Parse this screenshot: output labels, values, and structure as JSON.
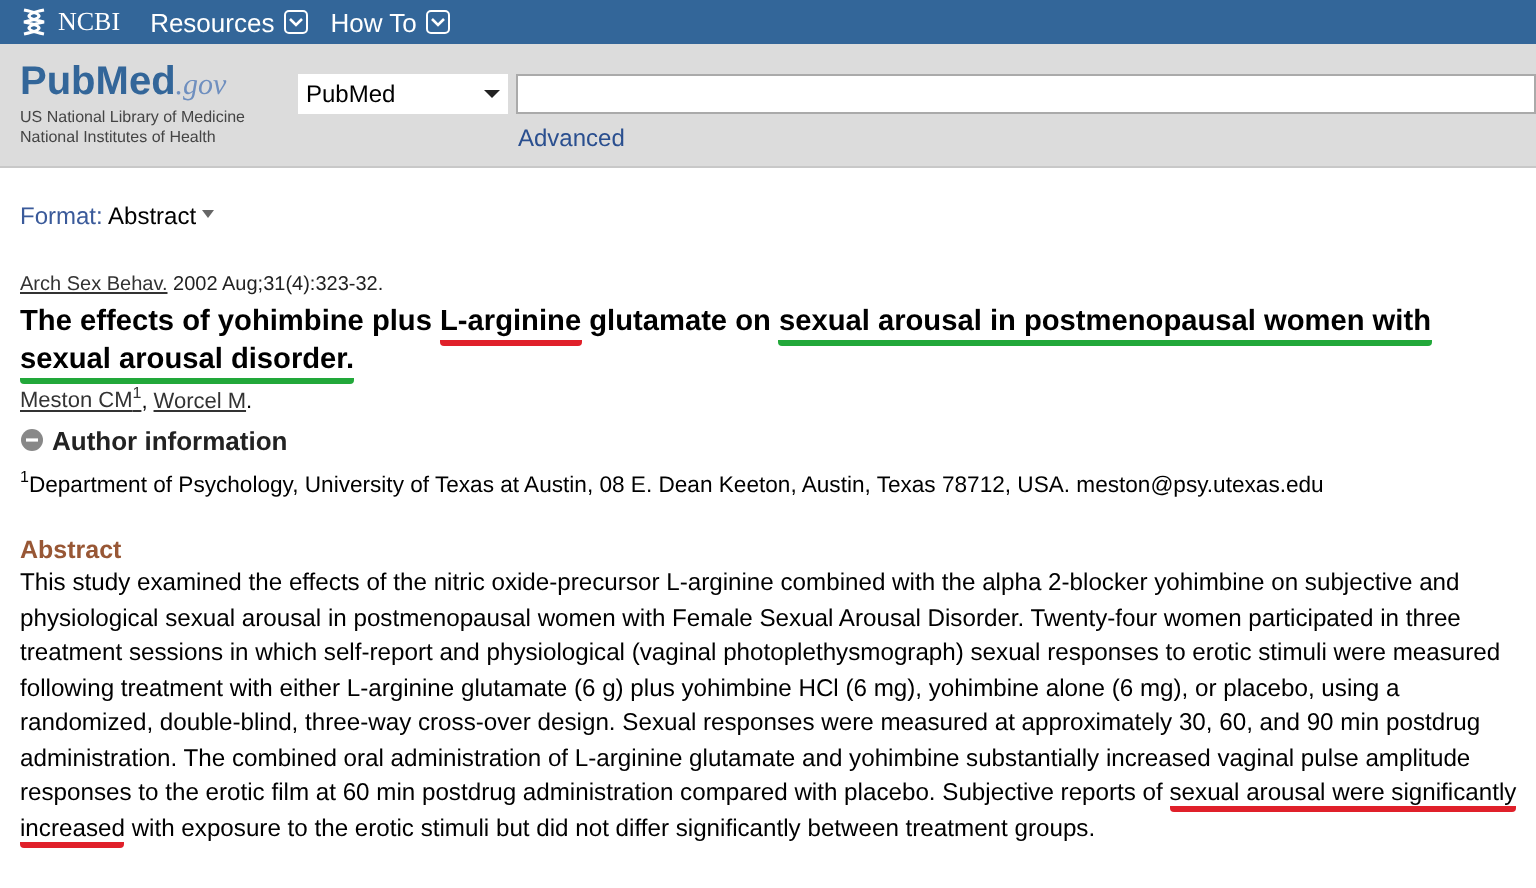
{
  "top_bar": {
    "brand": "NCBI",
    "menus": [
      "Resources",
      "How To"
    ]
  },
  "header": {
    "logo": {
      "pub": "Pub",
      "med": "Med",
      "gov": ".gov"
    },
    "org_lines": [
      "US National Library of Medicine",
      "National Institutes of Health"
    ],
    "database": "PubMed",
    "advanced_link": "Advanced"
  },
  "format": {
    "label": "Format:",
    "value": "Abstract"
  },
  "citation": {
    "journal": "Arch Sex Behav.",
    "details": "2002 Aug;31(4):323-32."
  },
  "title": [
    {
      "text": "The effects of yohimbine plus "
    },
    {
      "text": "L-arginine",
      "color": "#e0202a"
    },
    {
      "text": " glutamate on "
    },
    {
      "text": "sexual arousal in postmenopausal women with sexual arousal disorder.",
      "color": "#22a83a"
    }
  ],
  "authors": [
    {
      "name": "Meston CM",
      "sup": "1",
      "separator": ","
    },
    {
      "name": "Worcel M",
      "separator": "."
    }
  ],
  "author_info": {
    "heading": "Author information",
    "expanded": true,
    "affiliation_sup": "1",
    "affiliation": "Department of Psychology, University of Texas at Austin, 08 E. Dean Keeton, Austin, Texas 78712, USA. meston@psy.utexas.edu"
  },
  "abstract": {
    "heading": "Abstract",
    "segments": [
      {
        "text": "This study examined the effects of the nitric oxide-precursor L-arginine combined with the alpha 2-blocker yohimbine on subjective and physiological sexual arousal in postmenopausal women with Female Sexual Arousal Disorder. Twenty-four women participated in three treatment sessions in which self-report and physiological (vaginal photoplethysmograph) sexual responses to erotic stimuli were measured following treatment with either L-arginine glutamate (6 g) plus yohimbine HCl (6 mg), yohimbine alone (6 mg), or placebo, using a randomized, double-blind, three-way cross-over design. Sexual responses were measured at approximately 30, 60, and 90 min postdrug administration. The combined oral administration of L-arginine glutamate and yohimbine substantially increased vaginal pulse amplitude responses to the erotic film at 60 min postdrug administration compared with placebo. Subjective reports of "
      },
      {
        "text": "sexual arousal were significantly increased",
        "color": "#e0202a"
      },
      {
        "text": " with exposure to the erotic stimuli but did not differ significantly between treatment groups."
      }
    ]
  }
}
